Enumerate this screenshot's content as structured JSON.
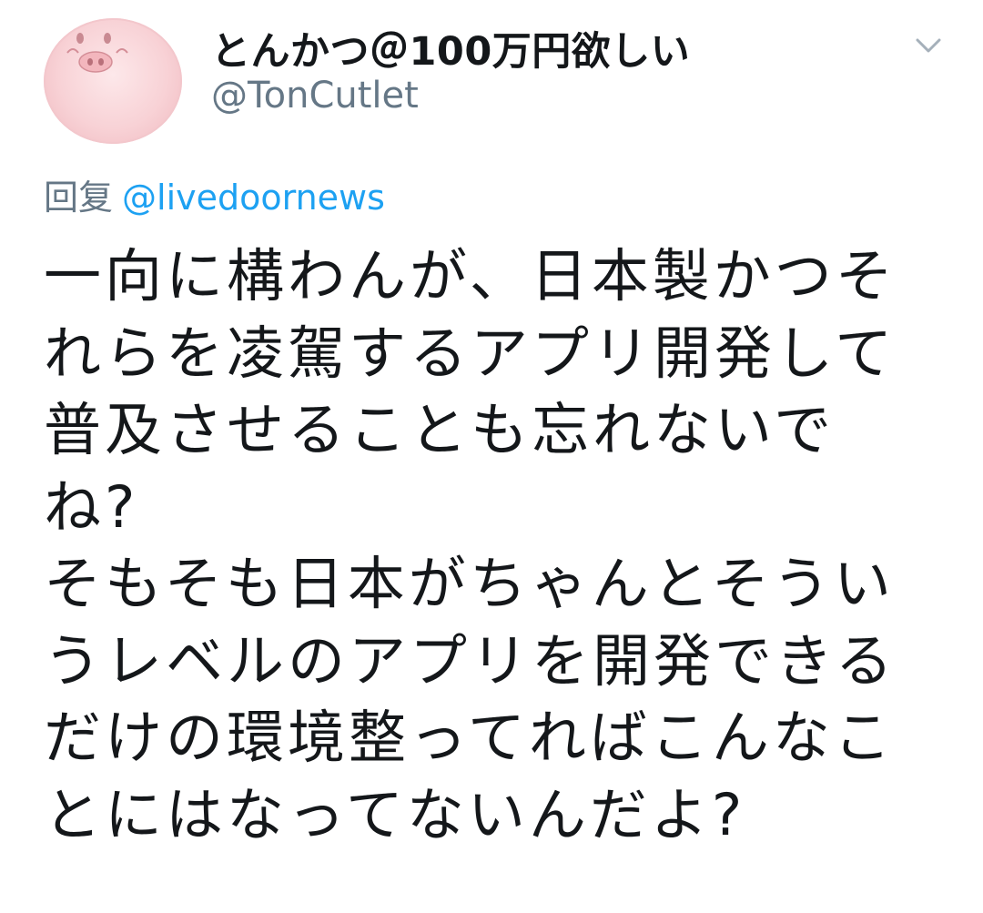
{
  "tweet": {
    "display_name": "とんかつ＠100万円欲しい",
    "handle": "@TonCutlet",
    "reply_label": "回复",
    "reply_mention": "@livedoornews",
    "body_lines": [
      "一向に構わんが、日本製かつそ",
      "れらを凌駕するアプリ開発して",
      "普及させることも忘れないで",
      "ね?",
      "そもそも日本がちゃんとそうい",
      "うレベルのアプリを開発できる",
      "だけの環境整ってればこんなこ",
      "とにはなってないんだよ?"
    ]
  },
  "icons": {
    "avatar": "pig-avatar",
    "menu": "chevron-down-icon"
  },
  "colors": {
    "text_primary": "#14171a",
    "text_secondary": "#657786",
    "link": "#1da1f2"
  }
}
